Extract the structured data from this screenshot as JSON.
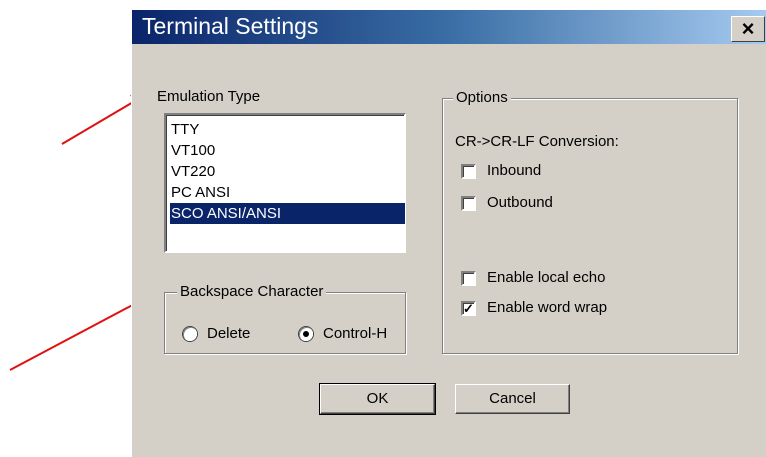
{
  "window": {
    "title": "Terminal Settings",
    "close_label": "×"
  },
  "emulation": {
    "label": "Emulation Type",
    "items": [
      "TTY",
      "VT100",
      "VT220",
      "PC ANSI",
      "SCO ANSI/ANSI"
    ],
    "selected": "SCO ANSI/ANSI"
  },
  "backspace": {
    "legend": "Backspace Character",
    "options": [
      {
        "label": "Delete",
        "checked": false
      },
      {
        "label": "Control-H",
        "checked": true
      }
    ]
  },
  "options": {
    "legend": "Options",
    "crlf_label": "CR->CR-LF Conversion:",
    "inbound": {
      "label": "Inbound",
      "checked": false
    },
    "outbound": {
      "label": "Outbound",
      "checked": false
    },
    "local_echo": {
      "label": "Enable local echo",
      "checked": false
    },
    "word_wrap": {
      "label": "Enable word wrap",
      "checked": true
    }
  },
  "buttons": {
    "ok": "OK",
    "cancel": "Cancel"
  },
  "colors": {
    "arrow": "#e01010",
    "selection": "#0a246a",
    "title_start": "#0a246a",
    "title_end": "#a6caf0"
  }
}
